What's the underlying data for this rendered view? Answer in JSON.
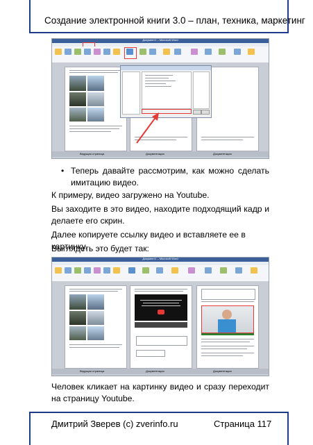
{
  "header": {
    "title": "Создание электронной книги 3.0 – план, техника, маркетинг"
  },
  "screenshot_top": {
    "window_title": "Документ1 – Microsoft Word",
    "dialog_title": "Вставка изображения",
    "page_labels": [
      "Ведущая страница",
      "Документация",
      "Документация"
    ],
    "accent_color": "#e53935"
  },
  "content": {
    "bullet_text": "Теперь давайте рассмотрим, как можно сделать имитацию видео.",
    "p1": "К примеру, видео загружено на Youtube.",
    "p2": "Вы заходите в это видео, находите подходящий кадр и делаете его скрин.",
    "p3": "Далее копируете ссылку видео и вставляете ее в картинку.",
    "p4": "Выглядеть это будет так:",
    "p5": "Человек кликает на картинку видео и сразу переходит на страницу Youtube."
  },
  "screenshot_bottom": {
    "window_title": "Документ1 – Microsoft Word",
    "page_labels": [
      "Ведущая страница",
      "Документация",
      "Документация"
    ]
  },
  "footer": {
    "author": "Дмитрий Зверев (с) zverinfo.ru",
    "page": "Страница 117"
  },
  "colors": {
    "frame": "#1e3a8a",
    "text": "#000000"
  }
}
